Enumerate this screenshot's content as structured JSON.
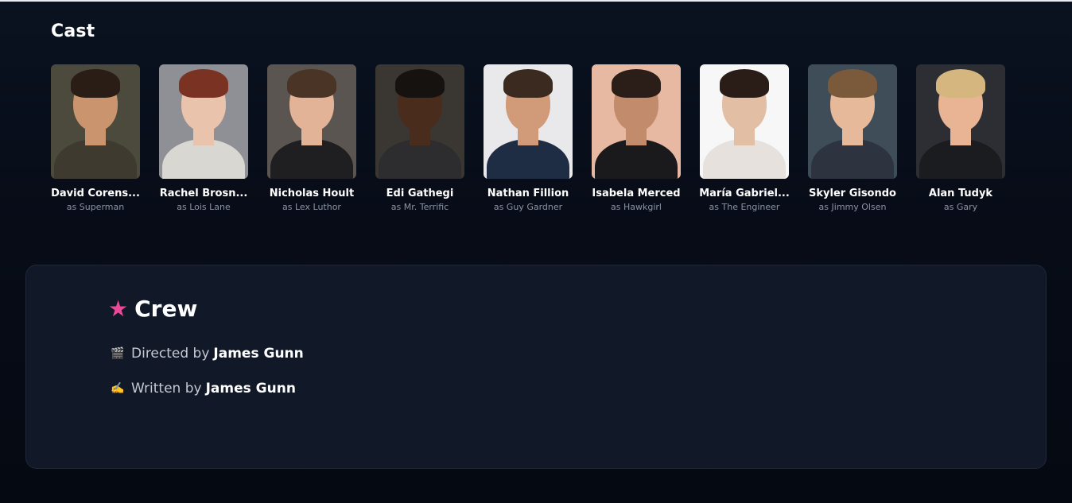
{
  "cast": {
    "title": "Cast",
    "members": [
      {
        "name": "David Corens...",
        "role": "as Superman",
        "bg": "#4b4a3d",
        "skin": "#c9946e",
        "hair": "#2a1d16",
        "body": "#3f3a30"
      },
      {
        "name": "Rachel Brosn...",
        "role": "as Lois Lane",
        "bg": "#8f9096",
        "skin": "#eac3ad",
        "hair": "#7a3222",
        "body": "#d9d7d2"
      },
      {
        "name": "Nicholas Hoult",
        "role": "as Lex Luthor",
        "bg": "#5a5550",
        "skin": "#e2b396",
        "hair": "#4a3425",
        "body": "#1f1f22"
      },
      {
        "name": "Edi Gathegi",
        "role": "as Mr. Terrific",
        "bg": "#3a3632",
        "skin": "#4a2c1d",
        "hair": "#161210",
        "body": "#2d2d30"
      },
      {
        "name": "Nathan Fillion",
        "role": "as Guy Gardner",
        "bg": "#e9e9ec",
        "skin": "#d19a78",
        "hair": "#3a2a20",
        "body": "#1f2d44"
      },
      {
        "name": "Isabela Merced",
        "role": "as Hawkgirl",
        "bg": "#e8b9a2",
        "skin": "#c28b6b",
        "hair": "#2b1d18",
        "body": "#1a1a1d"
      },
      {
        "name": "María Gabriel...",
        "role": "as The Engineer",
        "bg": "#f7f7f7",
        "skin": "#e2bea5",
        "hair": "#2a1c17",
        "body": "#e6e1dc"
      },
      {
        "name": "Skyler Gisondo",
        "role": "as Jimmy Olsen",
        "bg": "#3f4d59",
        "skin": "#e6b99a",
        "hair": "#7a5a3a",
        "body": "#2d3440"
      },
      {
        "name": "Alan Tudyk",
        "role": "as Gary",
        "bg": "#2c2e33",
        "skin": "#e8b493",
        "hair": "#d5b67e",
        "body": "#1b1c20"
      }
    ]
  },
  "crew": {
    "title": "Crew",
    "star_icon": "star-icon",
    "star_color": "#ec4899",
    "director": {
      "icon": "🎬",
      "icon_name": "clapperboard-icon",
      "label": "Directed by",
      "person": "James Gunn"
    },
    "writer": {
      "icon": "✍️",
      "icon_name": "writing-hand-icon",
      "label": "Written by",
      "person": "James Gunn"
    }
  }
}
